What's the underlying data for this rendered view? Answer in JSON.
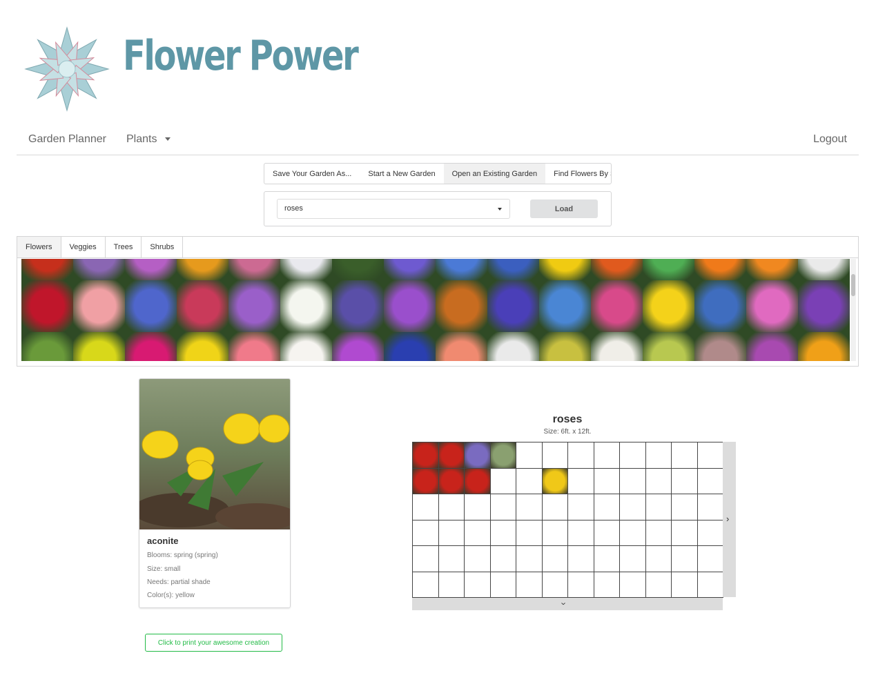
{
  "brand": {
    "title": "Flower Power",
    "logo_icon": "succulent-logo-icon"
  },
  "nav": {
    "garden_planner": "Garden Planner",
    "plants": "Plants",
    "logout": "Logout"
  },
  "actions": [
    "Save Your Garden As...",
    "Start a New Garden",
    "Open an Existing Garden",
    "Find Flowers By State"
  ],
  "active_action": "Open an Existing Garden",
  "load": {
    "selected": "roses",
    "button": "Load"
  },
  "categories": [
    "Flowers",
    "Veggies",
    "Trees",
    "Shrubs"
  ],
  "active_category": "Flowers",
  "thumbnails": {
    "row1": [
      "#c62f1c",
      "#8a66b3",
      "#b55fc4",
      "#e69a1d",
      "#cc6a92",
      "#e9e9ee",
      "#3a5e2a",
      "#6e5ad0",
      "#4b7ad6",
      "#3b5fbf",
      "#f0cb12",
      "#e05a1e",
      "#4fae54",
      "#f07a1a",
      "#f08820",
      "#eaeaea"
    ],
    "row2": [
      "#c0162b",
      "#f0a0a4",
      "#4f66cc",
      "#c93a5a",
      "#9a5fc9",
      "#f4f6ef",
      "#5a4fa8",
      "#9a4fcc",
      "#c86c20",
      "#4a3fb8",
      "#4a86d4",
      "#d84a8a",
      "#f4d21a",
      "#3f6dbf",
      "#e06ac0",
      "#7a40b5"
    ],
    "row3": [
      "#6a9a3a",
      "#d8d81a",
      "#d81a72",
      "#f0d418",
      "#f07a8a",
      "#f6f4f0",
      "#b04ad0",
      "#2a3fb0",
      "#f08a70",
      "#eaeaea",
      "#c8c040",
      "#f0eee8",
      "#b8c850",
      "#b08a8a",
      "#a84ab0",
      "#f0a018"
    ]
  },
  "selected_plant": {
    "name": "aconite",
    "blooms": "Blooms: spring (spring)",
    "size": "Size: small",
    "needs": "Needs: partial shade",
    "colors": "Color(s): yellow"
  },
  "print_button": "Click to print your awesome creation",
  "garden": {
    "title": "roses",
    "size": "Size: 6ft. x 12ft.",
    "rows": 6,
    "cols": 12,
    "planted": [
      {
        "row": 0,
        "col": 0,
        "color": "#c8231b"
      },
      {
        "row": 0,
        "col": 1,
        "color": "#c8231b"
      },
      {
        "row": 0,
        "col": 2,
        "color": "#7a6bc0"
      },
      {
        "row": 0,
        "col": 3,
        "color": "#8aa070"
      },
      {
        "row": 1,
        "col": 0,
        "color": "#c8231b"
      },
      {
        "row": 1,
        "col": 1,
        "color": "#c8231b"
      },
      {
        "row": 1,
        "col": 2,
        "color": "#c8231b"
      },
      {
        "row": 1,
        "col": 5,
        "color": "#f0c818"
      }
    ]
  }
}
